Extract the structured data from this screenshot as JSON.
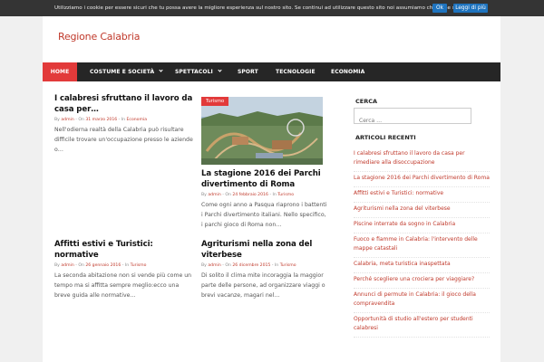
{
  "cookie": {
    "text": "Utilizziamo i cookie per essere sicuri che tu possa avere la migliore esperienza sul nostro sito. Se continui ad utilizzare questo sito noi assumiamo che tu ne sia felice.",
    "ok_label": "Ok",
    "more_label": "Leggi di più"
  },
  "site": {
    "title": "Regione Calabria"
  },
  "nav": [
    {
      "label": "HOME",
      "active": true
    },
    {
      "label": "COSTUME E SOCIETÀ",
      "dropdown": true
    },
    {
      "label": "SPETTACOLI",
      "dropdown": true
    },
    {
      "label": "SPORT"
    },
    {
      "label": "TECNOLOGIE"
    },
    {
      "label": "ECONOMIA"
    }
  ],
  "posts": [
    {
      "title": "I calabresi sfruttano il lavoro da casa per…",
      "meta_by": "By",
      "author": "admin",
      "meta_on": "- On",
      "date": "31 marzo 2016",
      "meta_in": "- In",
      "category": "Economia",
      "excerpt": "Nell'odierna realtà della Calabria può risultare difficile trovare un'occupazione presso le aziende o…"
    },
    {
      "badge": "Turismo",
      "title": "La stagione 2016 dei Parchi divertimento di Roma",
      "meta_by": "By",
      "author": "admin",
      "meta_on": "- On",
      "date": "24 febbraio 2016",
      "meta_in": "- In",
      "category": "Turismo",
      "excerpt": "Come ogni anno a Pasqua riaprono i battenti i Parchi divertimento italiani. Nello specifico, i parchi gioco di Roma non…"
    },
    {
      "title": "Affitti estivi e Turistici: normative",
      "meta_by": "By",
      "author": "admin",
      "meta_on": "- On",
      "date": "26 gennaio 2016",
      "meta_in": "- In",
      "category": "Turismo",
      "excerpt": "La seconda abitazione non si vende più come un tempo ma si affitta sempre meglio:ecco una breve guida alle normative…"
    },
    {
      "title": "Agriturismi nella zona del viterbese",
      "meta_by": "By",
      "author": "admin",
      "meta_on": "- On",
      "date": "26 dicembre 2015",
      "meta_in": "- In",
      "category": "Turismo",
      "excerpt": "Di solito il clima mite incoraggia la maggior parte delle persone, ad organizzare viaggi o brevi vacanze, magari nel…"
    }
  ],
  "sidebar": {
    "search_title": "CERCA",
    "search_placeholder": "Cerca …",
    "recent_title": "ARTICOLI RECENTI",
    "recent": [
      "I calabresi sfruttano il lavoro da casa per rimediare alla disoccupazione",
      "La stagione 2016 dei Parchi divertimento di Roma",
      "Affitti estivi e Turistici: normative",
      "Agriturismi nella zona del viterbese",
      "Piscine interrate da sogno in Calabria",
      "Fuoco e fiamme in Calabria: l'intervento delle mappe catastali",
      "Calabria, meta turistica inaspettata",
      "Perché scegliere una crociera per viaggiare?",
      "Annunci di permute in Calabria: il gioco della compravendita",
      "Opportunità di studio all'estero per studenti calabresi"
    ]
  },
  "colors": {
    "accent": "#e23a3a",
    "link": "#c0392b",
    "nav_bg": "#262626",
    "cookie_bg": "#343434",
    "button": "#1e73be"
  }
}
